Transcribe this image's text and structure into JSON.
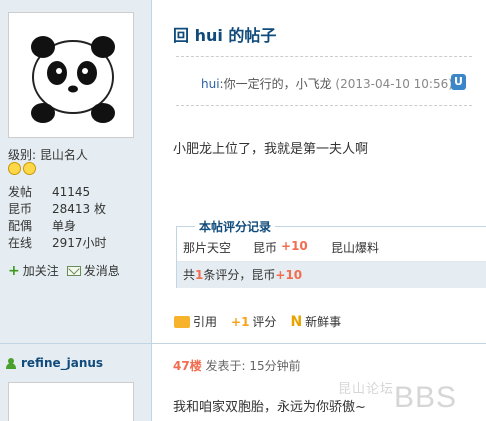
{
  "author": {
    "level_label": "级别:",
    "level_value": "昆山名人",
    "stats": [
      {
        "key": "发帖",
        "value": "41145"
      },
      {
        "key": "昆币",
        "value": "28413 枚"
      },
      {
        "key": "配偶",
        "value": "单身"
      },
      {
        "key": "在线",
        "value": "2917小时"
      }
    ],
    "follow_label": "加关注",
    "message_label": "发消息"
  },
  "post": {
    "title": "回 hui 的帖子",
    "quote": {
      "user": "hui",
      "text": ":你一定行的，小飞龙",
      "date": "(2013-04-10 10:56)",
      "icon": "U"
    },
    "body": "小肥龙上位了，我就是第一夫人啊"
  },
  "rating": {
    "header": "本帖评分记录",
    "row": {
      "user": "那片天空",
      "item": "昆币",
      "score": "+10",
      "reason": "昆山爆料"
    },
    "summary_prefix": "共",
    "summary_count": "1",
    "summary_mid": "条评分，昆币",
    "summary_score": "+10"
  },
  "toolbar": {
    "quote_label": "引用",
    "rate_label": "评分",
    "rate_icon": "+1",
    "new_label": "新鲜事",
    "new_icon": "N"
  },
  "next_post": {
    "username": "refine_janus",
    "floor": "47楼",
    "meta": "发表于: 15分钟前",
    "body": "我和咱家双胞胎，永远为你骄傲~"
  },
  "watermark": {
    "text": "昆山论坛",
    "brand": "BBS"
  },
  "colors": {
    "link": "#104b7c",
    "orange": "#f26c4f",
    "sidebar": "#e5edf2"
  }
}
